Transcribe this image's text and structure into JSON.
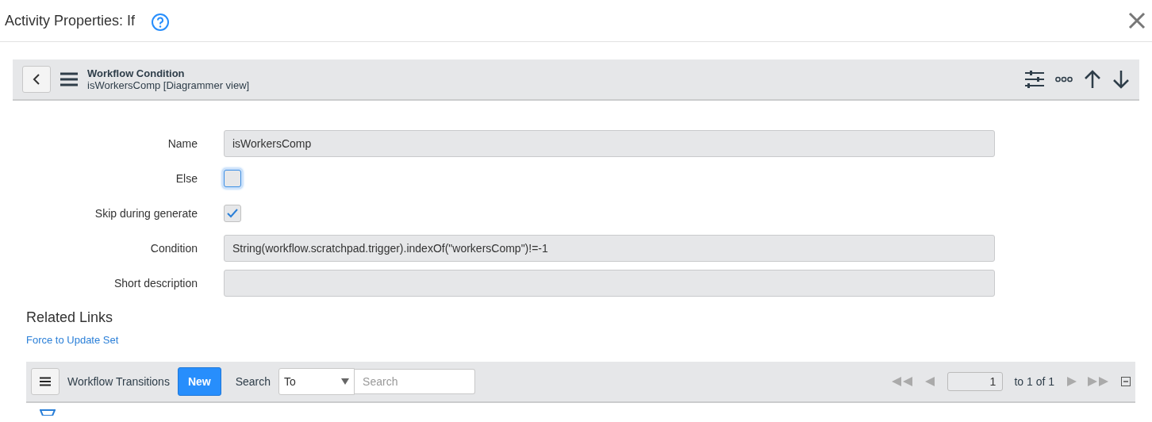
{
  "dialog": {
    "title": "Activity Properties: If"
  },
  "header": {
    "title": "Workflow Condition",
    "subtitle": "isWorkersComp [Diagrammer view]"
  },
  "fields": [
    {
      "kind": "text",
      "label": "Name",
      "value": "isWorkersComp"
    },
    {
      "kind": "checkbox",
      "label": "Else",
      "checked": false,
      "focused": true
    },
    {
      "kind": "checkbox",
      "label": "Skip during generate",
      "checked": true,
      "focused": false
    },
    {
      "kind": "text",
      "label": "Condition",
      "value": "String(workflow.scratchpad.trigger).indexOf(\"workersComp\")!=-1"
    },
    {
      "kind": "text",
      "label": "Short description"
    }
  ],
  "related_links": {
    "heading": "Related Links",
    "links": [
      "Force to Update Set"
    ]
  },
  "list": {
    "title": "Workflow Transitions",
    "new_button": "New",
    "search_label": "Search",
    "search_field": "To",
    "search_placeholder": "Search",
    "page": "1",
    "range": "to 1 of 1"
  }
}
